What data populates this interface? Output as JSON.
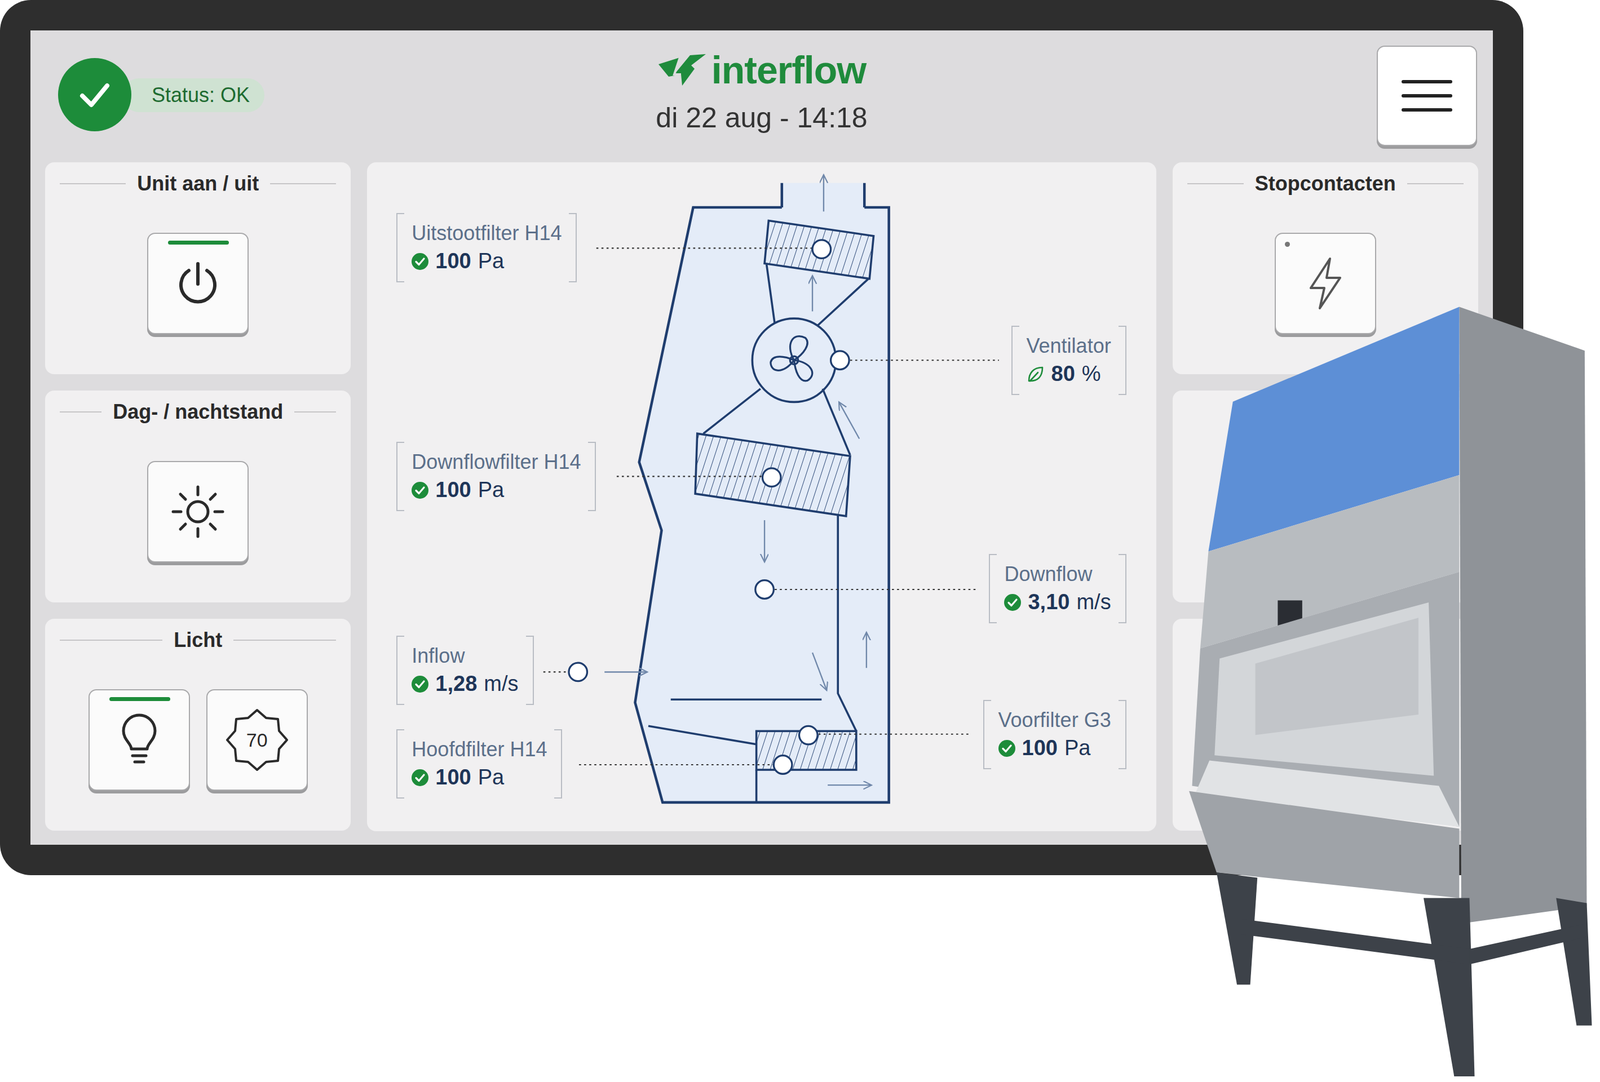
{
  "status": {
    "label": "Status: OK",
    "ok": true
  },
  "logo": "interflow",
  "datetime": "di 22 aug - 14:18",
  "controls": [
    {
      "title": "Unit aan / uit",
      "buttons": [
        {
          "kind": "power",
          "on": true
        }
      ]
    },
    {
      "title": "Dag- / nachtstand",
      "buttons": [
        {
          "kind": "sun",
          "on": false
        }
      ]
    },
    {
      "title": "Licht",
      "buttons": [
        {
          "kind": "bulb",
          "on": true
        },
        {
          "kind": "dimmer",
          "on": false,
          "label": "70"
        }
      ]
    }
  ],
  "right_panels": [
    {
      "title": "Stopcontacten",
      "buttons": [
        {
          "kind": "socket",
          "on": false
        }
      ]
    }
  ],
  "sensors": [
    {
      "label": "Uitstootfilter H14",
      "value": "100",
      "unit": "Pa",
      "kind": "ok"
    },
    {
      "label": "Ventilator",
      "value": "80",
      "unit": "%",
      "kind": "eco"
    },
    {
      "label": "Downflowfilter H14",
      "value": "100",
      "unit": "Pa",
      "kind": "ok"
    },
    {
      "label": "Downflow",
      "value": "3,10",
      "unit": "m/s",
      "kind": "ok"
    },
    {
      "label": "Inflow",
      "value": "1,28",
      "unit": "m/s",
      "kind": "ok"
    },
    {
      "label": "Voorfilter G3",
      "value": "100",
      "unit": "Pa",
      "kind": "ok"
    },
    {
      "label": "Hoofdfilter H14",
      "value": "100",
      "unit": "Pa",
      "kind": "ok"
    }
  ]
}
